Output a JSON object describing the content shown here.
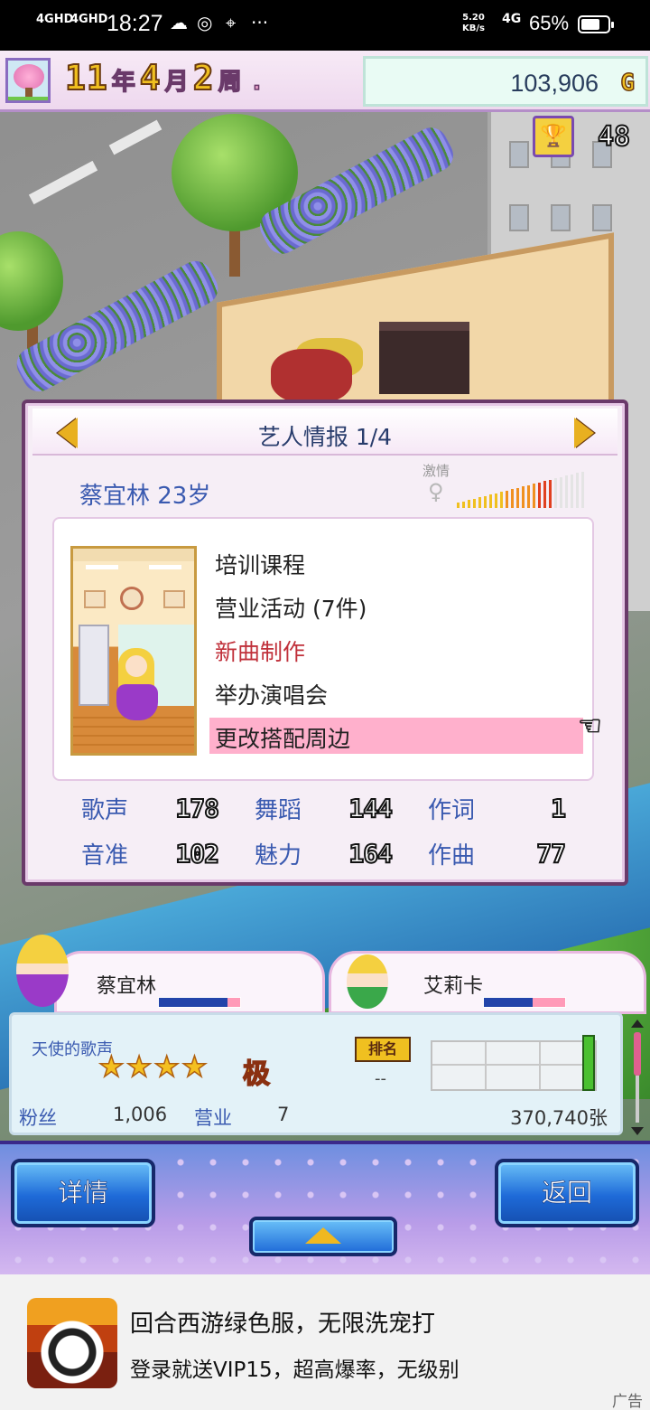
{
  "status_bar": {
    "network1": "4GHD",
    "network2": "4GHD",
    "time": "18:27",
    "speed_value": "5.20",
    "speed_unit": "KB/s",
    "signal": "4G",
    "battery": "65%",
    "icons": [
      "cloud-icon",
      "wechat-icon",
      "location-icon",
      "more-icon",
      "wifi-icon",
      "battery-icon"
    ]
  },
  "hud": {
    "year": "11",
    "year_unit": "年",
    "month": "4",
    "month_unit": "月",
    "week": "2",
    "week_unit": "周",
    "money": "103,906",
    "currency": "G",
    "trophy_count": "48"
  },
  "artist_panel": {
    "title": "艺人情报 1/4",
    "artist_name": "蔡宜林 23岁",
    "passion_label": "激情",
    "passion_level": 0.75,
    "menu": [
      {
        "label": "培训课程",
        "color": "normal"
      },
      {
        "label": "营业活动 (7件)",
        "color": "normal"
      },
      {
        "label": "新曲制作",
        "color": "red"
      },
      {
        "label": "举办演唱会",
        "color": "normal"
      },
      {
        "label": "更改搭配周边",
        "color": "highlight"
      }
    ],
    "stats": [
      {
        "label": "歌声",
        "value": "178"
      },
      {
        "label": "舞蹈",
        "value": "144"
      },
      {
        "label": "作词",
        "value": "1"
      },
      {
        "label": "音准",
        "value": "102"
      },
      {
        "label": "魅力",
        "value": "164"
      },
      {
        "label": "作曲",
        "value": "77"
      }
    ]
  },
  "characters": [
    {
      "name": "蔡宜林",
      "bar_level": 0.85
    },
    {
      "name": "艾莉卡",
      "bar_level": 0.6
    }
  ],
  "song": {
    "title": "天使的歌声",
    "stars": 4,
    "grade": "极",
    "rank_label": "排名",
    "rank_value": "--",
    "fans_label": "粉丝",
    "fans_value": "1,006",
    "business_label": "营业",
    "business_value": "7",
    "sales": "370,740张"
  },
  "actions": {
    "details": "详情",
    "back": "返回"
  },
  "ad": {
    "title": "回合西游绿色服，无限洗宠打",
    "subtitle": "登录就送VIP15，超高爆率，无级别",
    "tag": "广告"
  }
}
